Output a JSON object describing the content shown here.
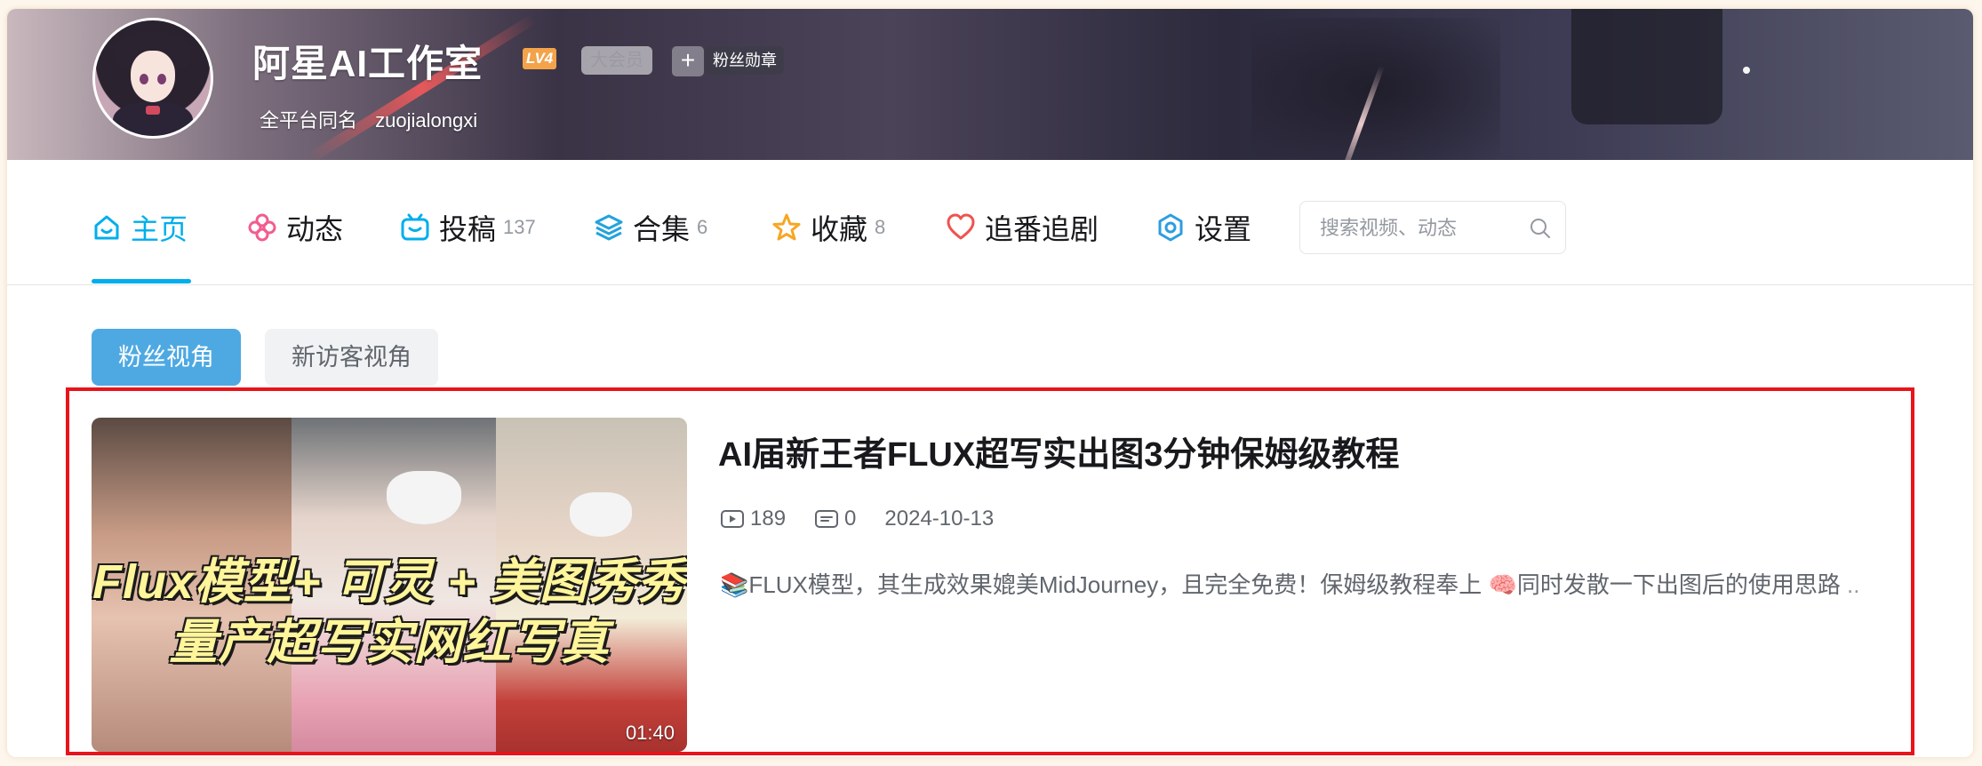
{
  "profile": {
    "name": "阿星AI工作室",
    "level_badge": "LV4",
    "vip_badge": "大会员",
    "medal_plus": "+",
    "medal_label": "粉丝勋章",
    "alias_label": "全平台同名",
    "alias_value": "zuojialongxi"
  },
  "nav": {
    "items": [
      {
        "label": "主页",
        "count": "",
        "icon": "home-icon"
      },
      {
        "label": "动态",
        "count": "",
        "icon": "pinwheel-icon"
      },
      {
        "label": "投稿",
        "count": "137",
        "icon": "tv-icon"
      },
      {
        "label": "合集",
        "count": "6",
        "icon": "layers-icon"
      },
      {
        "label": "收藏",
        "count": "8",
        "icon": "star-icon"
      },
      {
        "label": "追番追剧",
        "count": "",
        "icon": "heart-icon"
      },
      {
        "label": "设置",
        "count": "",
        "icon": "hexagon-gear-icon"
      }
    ],
    "active": "主页",
    "search_placeholder": "搜索视频、动态"
  },
  "view_tabs": {
    "fan": "粉丝视角",
    "visitor": "新访客视角",
    "active": "粉丝视角"
  },
  "video": {
    "title": "AI届新王者FLUX超写实出图3分钟保姆级教程",
    "plays": "189",
    "comments": "0",
    "date": "2024-10-13",
    "duration": "01:40",
    "thumb_caption_line1": "Flux模型+ 可灵 + 美图秀秀",
    "thumb_caption_line2": "量产超写实网红写真",
    "description": "📚FLUX模型，其生成效果媲美MidJourney，且完全免费！保姆级教程奉上 🧠同时发散一下出图后的使用思路",
    "description_ellipsis": " .."
  },
  "colors": {
    "accent": "#00aeec",
    "tab_active_bg": "#4ea9e2",
    "highlight_border": "#e8131b",
    "level_badge_bg": "#f3a34a"
  }
}
